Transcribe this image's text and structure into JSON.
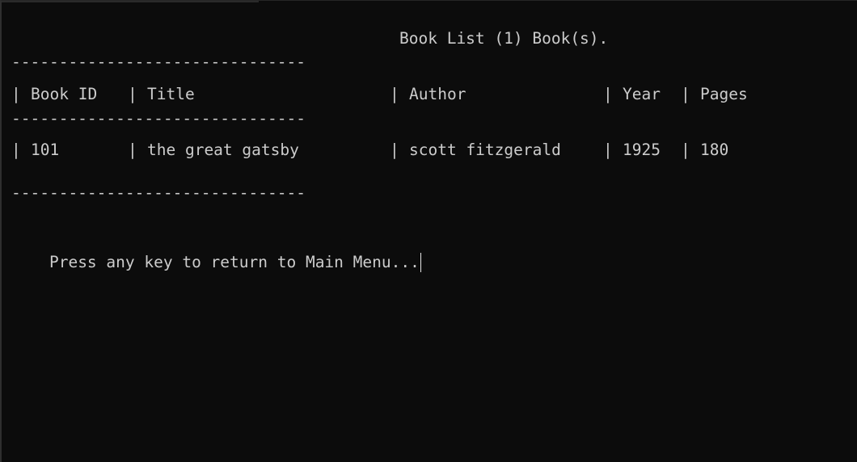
{
  "terminal": {
    "heading": "Book List (1) Book(s).",
    "rule": "-------------------------------",
    "separator": "|",
    "table": {
      "columns": [
        "Book ID",
        "Title",
        "Author",
        "Year",
        "Pages"
      ],
      "rows": [
        [
          "101",
          "the great gatsby",
          "scott fitzgerald",
          "1925",
          "180"
        ]
      ]
    },
    "prompt": "Press any key to return to Main Menu..."
  }
}
